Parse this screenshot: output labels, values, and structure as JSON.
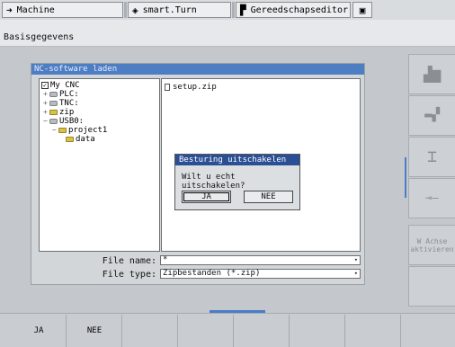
{
  "tabs": [
    {
      "label": "Machine",
      "icon": "arrow-right-icon"
    },
    {
      "label": "smart.Turn",
      "icon": "diamond-arrow-icon"
    },
    {
      "label": "Gereedschapseditor",
      "icon": "tool-icon"
    },
    {
      "label": "",
      "icon": "save-disk-icon"
    }
  ],
  "subtitle": "Basisgegevens",
  "panel": {
    "title": "NC-software laden",
    "tree": [
      {
        "label": "My CNC",
        "kind": "root"
      },
      {
        "label": "PLC:",
        "kind": "drive"
      },
      {
        "label": "TNC:",
        "kind": "drive"
      },
      {
        "label": "zip",
        "kind": "folder"
      },
      {
        "label": "USB0:",
        "kind": "drive"
      },
      {
        "label": "project1",
        "kind": "folder"
      },
      {
        "label": "data",
        "kind": "folder"
      }
    ],
    "files": [
      "setup.zip"
    ],
    "file_name_label": "File name:",
    "file_name_value": "*",
    "file_type_label": "File type:",
    "file_type_value": "Zipbestanden (*.zip)"
  },
  "dialog": {
    "title": "Besturing uitschakelen",
    "message": "Wilt u echt uitschakelen?",
    "yes": "JA",
    "no": "NEE"
  },
  "vertical_softkeys": [
    "",
    "",
    "",
    "",
    "W Achse aktivieren",
    ""
  ],
  "bottom_softkeys": [
    "JA",
    "NEE",
    "",
    "",
    "",
    "",
    "",
    ""
  ]
}
